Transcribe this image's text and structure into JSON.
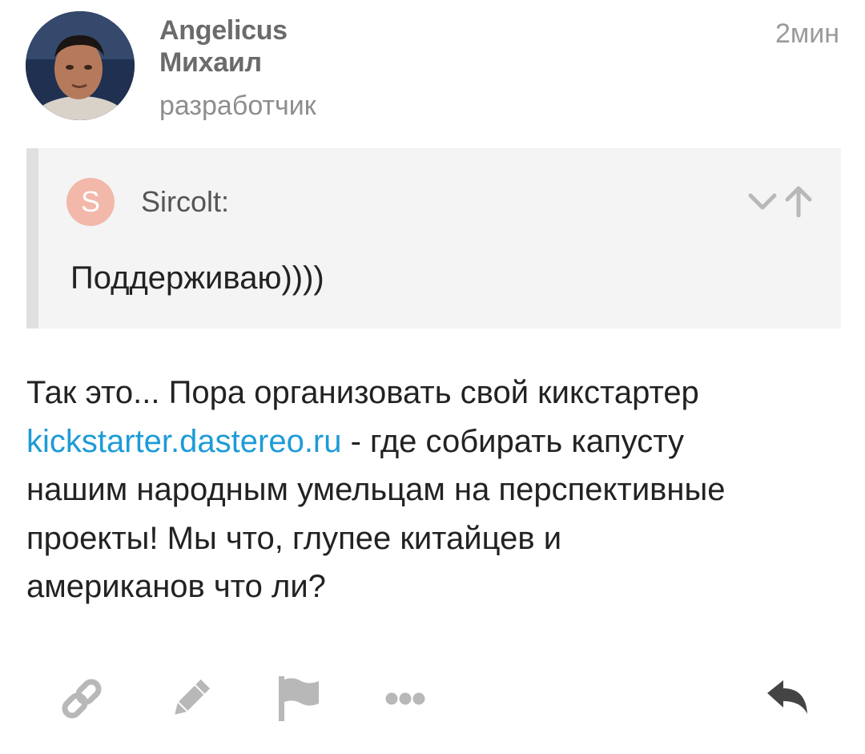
{
  "post": {
    "author": {
      "username": "Angelicus",
      "name": "Михаил",
      "role": "разработчик"
    },
    "time": "2мин",
    "quote": {
      "avatar_letter": "S",
      "author": "Sircolt:",
      "text": "Поддерживаю))))"
    },
    "body": {
      "line1": "Так это... Пора организовать свой кикстартер",
      "link": "kickstarter.dastereo.ru",
      "line2_rest": " - где собирать капусту",
      "line3": "нашим народным умельцам на перспективные",
      "line4": "проекты! Мы что, глупее китайцев и",
      "line5": "американов что ли?"
    },
    "actions": {
      "link_icon": "link-icon",
      "edit_icon": "pencil-icon",
      "flag_icon": "flag-icon",
      "more_icon": "more-dots-icon",
      "reply_icon": "reply-icon"
    },
    "colors": {
      "link": "#1e9bd7",
      "quote_bg": "#f4f4f4",
      "quote_avatar": "#f2b8aa",
      "icon_gray": "#b8b8b8"
    }
  }
}
